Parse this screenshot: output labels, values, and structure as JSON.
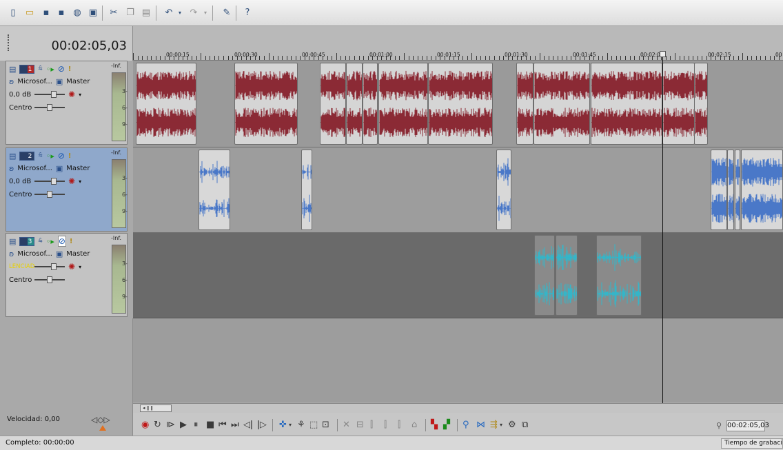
{
  "toolbar": {
    "icons": [
      "new-file-icon",
      "open-icon",
      "save-icon",
      "save-as-icon",
      "render-icon",
      "properties-icon",
      "cut-icon",
      "copy-icon",
      "paste-icon",
      "undo-icon",
      "redo-icon",
      "normal-edit-tool-icon",
      "help-icon"
    ]
  },
  "time_display": "00:02:05,03",
  "ruler": {
    "marks": [
      "00:00:15",
      "00:00:30",
      "00:00:45",
      "00:01:00",
      "00:01:15",
      "00:01:30",
      "00:01:45",
      "00:02:0",
      "00:02:15",
      "00"
    ]
  },
  "tracks": [
    {
      "number": "1",
      "name": "Microsof...",
      "bus": "Master",
      "volume": "0,0 dB",
      "pan": "Centro",
      "meter_top": "-Inf.",
      "meter_ticks": [
        "3-",
        "6-",
        "9-"
      ],
      "color": "#b02a2a"
    },
    {
      "number": "2",
      "name": "Microsof...",
      "bus": "Master",
      "volume": "0,0 dB",
      "pan": "Centro",
      "meter_top": "-Inf.",
      "meter_ticks": [
        "3-",
        "6-",
        "9-"
      ],
      "color": "#3a6ac8"
    },
    {
      "number": "3",
      "name": "Microsof...",
      "bus": "Master",
      "volume": "LENCIAD",
      "pan": "Centro",
      "meter_top": "-Inf.",
      "meter_ticks": [
        "3-",
        "6-",
        "9-"
      ],
      "color": "#2aa0b0"
    }
  ],
  "bottom": {
    "speed_label": "Velocidad: 0,00",
    "time_box": "00:02:05,03",
    "status_left": "Completo: 00:00:00",
    "status_right": "Tiempo de grabación"
  },
  "colors": {
    "wave_track1": "#8b2a35",
    "wave_track2": "#4a78c8",
    "wave_track3": "#35b5c8"
  }
}
